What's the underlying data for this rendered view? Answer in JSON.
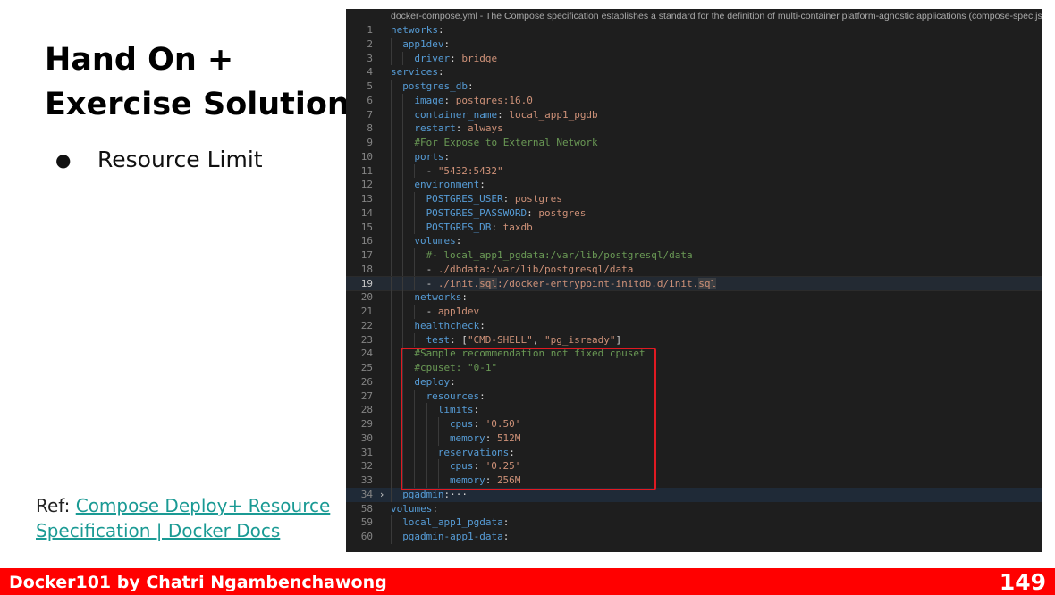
{
  "slide": {
    "title_line1": "Hand On +",
    "title_line2": "Exercise Solution",
    "bullet_symbol": "●",
    "bullet_text": "Resource Limit",
    "ref_prefix": "Ref: ",
    "ref_link_line1": "Compose Deploy+ Resource",
    "ref_link_line2": "Specification | Docker Docs"
  },
  "editor": {
    "schema_hint": "docker-compose.yml - The Compose specification establishes a standard for the definition of multi-container platform-agnostic applications (compose-spec.json)",
    "active_line": "19",
    "lines": [
      {
        "n": "1",
        "indent": 0,
        "parts": [
          [
            "k",
            "networks"
          ],
          [
            "p",
            ":"
          ]
        ]
      },
      {
        "n": "2",
        "indent": 1,
        "parts": [
          [
            "k",
            "app1dev"
          ],
          [
            "p",
            ":"
          ]
        ]
      },
      {
        "n": "3",
        "indent": 2,
        "parts": [
          [
            "k",
            "driver"
          ],
          [
            "p",
            ": "
          ],
          [
            "v",
            "bridge"
          ]
        ]
      },
      {
        "n": "4",
        "indent": 0,
        "parts": [
          [
            "k",
            "services"
          ],
          [
            "p",
            ":"
          ]
        ]
      },
      {
        "n": "5",
        "indent": 1,
        "parts": [
          [
            "k",
            "postgres_db"
          ],
          [
            "p",
            ":"
          ]
        ]
      },
      {
        "n": "6",
        "indent": 2,
        "parts": [
          [
            "k",
            "image"
          ],
          [
            "p",
            ": "
          ],
          [
            "vs",
            "postgres"
          ],
          [
            "v",
            ":16.0"
          ]
        ]
      },
      {
        "n": "7",
        "indent": 2,
        "parts": [
          [
            "k",
            "container_name"
          ],
          [
            "p",
            ": "
          ],
          [
            "v",
            "local_app1_pgdb"
          ]
        ]
      },
      {
        "n": "8",
        "indent": 2,
        "parts": [
          [
            "k",
            "restart"
          ],
          [
            "p",
            ": "
          ],
          [
            "v",
            "always"
          ]
        ]
      },
      {
        "n": "9",
        "indent": 2,
        "parts": [
          [
            "c",
            "#For Expose to External Network"
          ]
        ]
      },
      {
        "n": "10",
        "indent": 2,
        "parts": [
          [
            "k",
            "ports"
          ],
          [
            "p",
            ":"
          ]
        ]
      },
      {
        "n": "11",
        "indent": 3,
        "parts": [
          [
            "p",
            "- "
          ],
          [
            "v",
            "\"5432:5432\""
          ]
        ]
      },
      {
        "n": "12",
        "indent": 2,
        "parts": [
          [
            "k",
            "environment"
          ],
          [
            "p",
            ":"
          ]
        ]
      },
      {
        "n": "13",
        "indent": 3,
        "parts": [
          [
            "k",
            "POSTGRES_USER"
          ],
          [
            "p",
            ": "
          ],
          [
            "v",
            "postgres"
          ]
        ]
      },
      {
        "n": "14",
        "indent": 3,
        "parts": [
          [
            "k",
            "POSTGRES_PASSWORD"
          ],
          [
            "p",
            ": "
          ],
          [
            "v",
            "postgres"
          ]
        ]
      },
      {
        "n": "15",
        "indent": 3,
        "parts": [
          [
            "k",
            "POSTGRES_DB"
          ],
          [
            "p",
            ": "
          ],
          [
            "v",
            "taxdb"
          ]
        ]
      },
      {
        "n": "16",
        "indent": 2,
        "parts": [
          [
            "k",
            "volumes"
          ],
          [
            "p",
            ":"
          ]
        ]
      },
      {
        "n": "17",
        "indent": 3,
        "parts": [
          [
            "c",
            "#- local_app1_pgdata:/var/lib/postgresql/data"
          ]
        ]
      },
      {
        "n": "18",
        "indent": 3,
        "parts": [
          [
            "p",
            "- "
          ],
          [
            "v",
            "./dbdata:/var/lib/postgresql/data"
          ]
        ]
      },
      {
        "n": "19",
        "indent": 3,
        "parts": [
          [
            "p",
            "- "
          ],
          [
            "v",
            "./init."
          ],
          [
            "vh",
            "sql"
          ],
          [
            "v",
            ":/docker-entrypoint-initdb.d/init."
          ],
          [
            "vh",
            "sql"
          ]
        ]
      },
      {
        "n": "20",
        "indent": 2,
        "parts": [
          [
            "k",
            "networks"
          ],
          [
            "p",
            ":"
          ]
        ]
      },
      {
        "n": "21",
        "indent": 3,
        "parts": [
          [
            "p",
            "- "
          ],
          [
            "v",
            "app1dev"
          ]
        ]
      },
      {
        "n": "22",
        "indent": 2,
        "parts": [
          [
            "k",
            "healthcheck"
          ],
          [
            "p",
            ":"
          ]
        ]
      },
      {
        "n": "23",
        "indent": 3,
        "parts": [
          [
            "k",
            "test"
          ],
          [
            "p",
            ": ["
          ],
          [
            "v",
            "\"CMD-SHELL\""
          ],
          [
            "p",
            ", "
          ],
          [
            "v",
            "\"pg_isready\""
          ],
          [
            "p",
            "]"
          ]
        ]
      },
      {
        "n": "24",
        "indent": 2,
        "parts": [
          [
            "c",
            "#Sample recommendation not fixed cpuset"
          ]
        ]
      },
      {
        "n": "25",
        "indent": 2,
        "parts": [
          [
            "c",
            "#cpuset: \"0-1\""
          ]
        ]
      },
      {
        "n": "26",
        "indent": 2,
        "parts": [
          [
            "k",
            "deploy"
          ],
          [
            "p",
            ":"
          ]
        ]
      },
      {
        "n": "27",
        "indent": 3,
        "parts": [
          [
            "k",
            "resources"
          ],
          [
            "p",
            ":"
          ]
        ]
      },
      {
        "n": "28",
        "indent": 4,
        "parts": [
          [
            "k",
            "limits"
          ],
          [
            "p",
            ":"
          ]
        ]
      },
      {
        "n": "29",
        "indent": 5,
        "parts": [
          [
            "k",
            "cpus"
          ],
          [
            "p",
            ": "
          ],
          [
            "v",
            "'0.50'"
          ]
        ]
      },
      {
        "n": "30",
        "indent": 5,
        "parts": [
          [
            "k",
            "memory"
          ],
          [
            "p",
            ": "
          ],
          [
            "v",
            "512M"
          ]
        ]
      },
      {
        "n": "31",
        "indent": 4,
        "parts": [
          [
            "k",
            "reservations"
          ],
          [
            "p",
            ":"
          ]
        ]
      },
      {
        "n": "32",
        "indent": 5,
        "parts": [
          [
            "k",
            "cpus"
          ],
          [
            "p",
            ": "
          ],
          [
            "v",
            "'0.25'"
          ]
        ]
      },
      {
        "n": "33",
        "indent": 5,
        "parts": [
          [
            "k",
            "memory"
          ],
          [
            "p",
            ": "
          ],
          [
            "v",
            "256M"
          ]
        ]
      },
      {
        "n": "34",
        "indent": 1,
        "fold": true,
        "parts": [
          [
            "k",
            "pgadmin"
          ],
          [
            "p",
            ":"
          ],
          [
            "p",
            "···"
          ]
        ]
      },
      {
        "n": "58",
        "indent": 0,
        "parts": [
          [
            "k",
            "volumes"
          ],
          [
            "p",
            ":"
          ]
        ]
      },
      {
        "n": "59",
        "indent": 1,
        "parts": [
          [
            "k",
            "local_app1_pgdata"
          ],
          [
            "p",
            ":"
          ]
        ]
      },
      {
        "n": "60",
        "indent": 1,
        "parts": [
          [
            "k",
            "pgadmin-app1-data"
          ],
          [
            "p",
            ":"
          ]
        ]
      }
    ]
  },
  "footer": {
    "author": "Docker101 by Chatri Ngambenchawong",
    "page_number": "149"
  },
  "colors": {
    "footer_bg": "#ff0000",
    "link": "#1a9a94",
    "editor_bg": "#1e1e1e",
    "highlight_box": "#e01a22"
  }
}
